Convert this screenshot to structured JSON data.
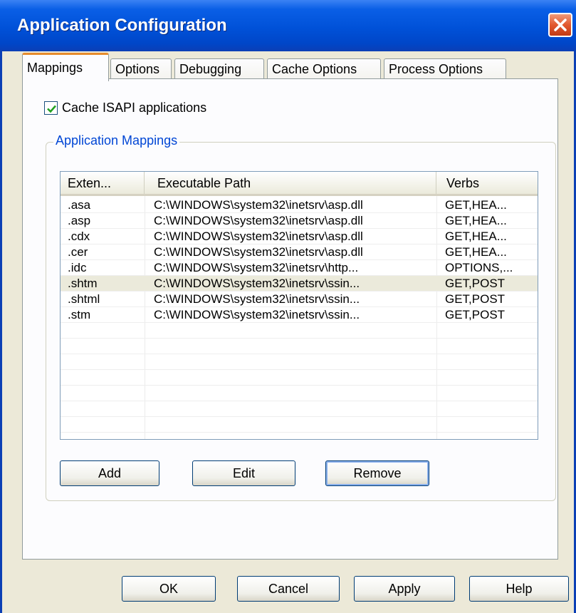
{
  "window": {
    "title": "Application Configuration"
  },
  "tabs": [
    {
      "label": "Mappings",
      "active": true
    },
    {
      "label": "Options",
      "active": false
    },
    {
      "label": "Debugging",
      "active": false
    },
    {
      "label": "Cache Options",
      "active": false
    },
    {
      "label": "Process Options",
      "active": false
    }
  ],
  "cache_isapi": {
    "label": "Cache ISAPI applications",
    "checked": true
  },
  "mappings_group": {
    "label": "Application Mappings",
    "columns": [
      "Exten...",
      "Executable Path",
      "Verbs"
    ],
    "rows": [
      {
        "ext": ".asa",
        "path": "C:\\WINDOWS\\system32\\inetsrv\\asp.dll",
        "verbs": "GET,HEA..."
      },
      {
        "ext": ".asp",
        "path": "C:\\WINDOWS\\system32\\inetsrv\\asp.dll",
        "verbs": "GET,HEA..."
      },
      {
        "ext": ".cdx",
        "path": "C:\\WINDOWS\\system32\\inetsrv\\asp.dll",
        "verbs": "GET,HEA..."
      },
      {
        "ext": ".cer",
        "path": "C:\\WINDOWS\\system32\\inetsrv\\asp.dll",
        "verbs": "GET,HEA..."
      },
      {
        "ext": ".idc",
        "path": "C:\\WINDOWS\\system32\\inetsrv\\http...",
        "verbs": "OPTIONS,..."
      },
      {
        "ext": ".shtm",
        "path": "C:\\WINDOWS\\system32\\inetsrv\\ssin...",
        "verbs": "GET,POST",
        "selected": true
      },
      {
        "ext": ".shtml",
        "path": "C:\\WINDOWS\\system32\\inetsrv\\ssin...",
        "verbs": "GET,POST"
      },
      {
        "ext": ".stm",
        "path": "C:\\WINDOWS\\system32\\inetsrv\\ssin...",
        "verbs": "GET,POST"
      }
    ],
    "buttons": {
      "add": "Add",
      "edit": "Edit",
      "remove": "Remove"
    }
  },
  "footer": {
    "ok": "OK",
    "cancel": "Cancel",
    "apply": "Apply",
    "help": "Help"
  },
  "colors": {
    "titlebar": "#0051d8",
    "tab_highlight": "#e68b2c",
    "group_label": "#0046d5",
    "selected_row": "#ebeadb"
  }
}
